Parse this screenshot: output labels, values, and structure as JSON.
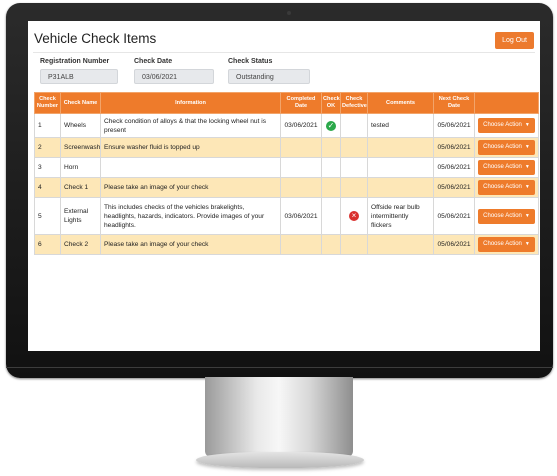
{
  "page": {
    "title": "Vehicle Check Items",
    "logout_label": "Log Out"
  },
  "fields": {
    "registration_label": "Registration Number",
    "registration_value": "P31ALB",
    "check_date_label": "Check Date",
    "check_date_value": "03/06/2021",
    "check_status_label": "Check Status",
    "check_status_value": "Outstanding"
  },
  "table": {
    "headers": [
      "Check Number",
      "Check Name",
      "Information",
      "Completed Date",
      "Check OK",
      "Check Defective",
      "Comments",
      "Next Check Date",
      ""
    ],
    "action_label": "Choose Action",
    "rows": [
      {
        "num": "1",
        "name": "Wheels",
        "info": "Check condition of alloys & that the locking wheel nut is present",
        "completed": "03/06/2021",
        "ok": "check-icon",
        "defective": "",
        "comments": "tested",
        "next": "05/06/2021"
      },
      {
        "num": "2",
        "name": "Screenwash",
        "info": "Ensure washer fluid is topped up",
        "completed": "",
        "ok": "",
        "defective": "",
        "comments": "",
        "next": "05/06/2021"
      },
      {
        "num": "3",
        "name": "Horn",
        "info": "",
        "completed": "",
        "ok": "",
        "defective": "",
        "comments": "",
        "next": "05/06/2021"
      },
      {
        "num": "4",
        "name": "Check 1",
        "info": "Please take an image of your check",
        "completed": "",
        "ok": "",
        "defective": "",
        "comments": "",
        "next": "05/06/2021"
      },
      {
        "num": "5",
        "name": "External Lights",
        "info": "This includes checks of the vehicles brakelights, headlights, hazards, indicators. Provide images of your headlights.",
        "completed": "03/06/2021",
        "ok": "",
        "defective": "cross-icon",
        "comments": "Offside rear bulb intermittently flickers",
        "next": "05/06/2021"
      },
      {
        "num": "6",
        "name": "Check 2",
        "info": "Please take an image of your check",
        "completed": "",
        "ok": "",
        "defective": "",
        "comments": "",
        "next": "05/06/2021"
      }
    ]
  },
  "colors": {
    "accent": "#ee7b2b",
    "row_alt": "#fde7b7",
    "ok": "#2ba84a",
    "defective": "#d9312f"
  }
}
